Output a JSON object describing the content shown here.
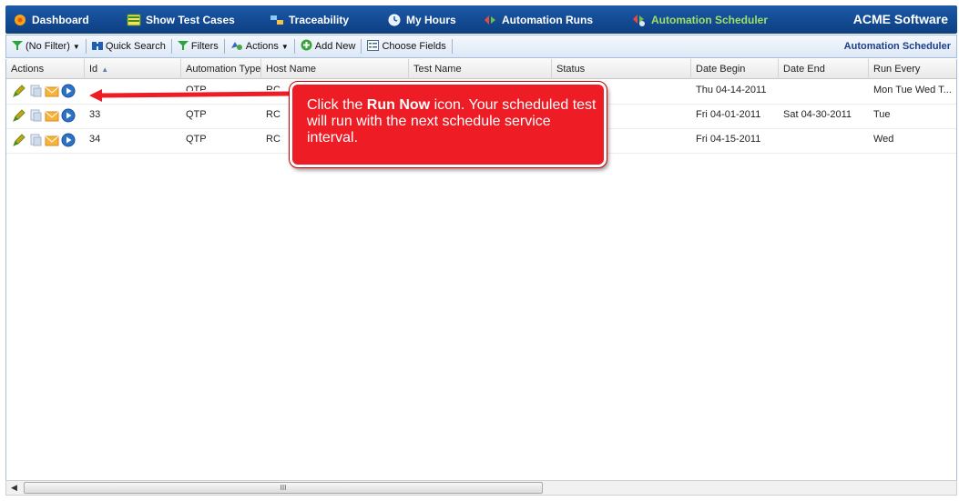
{
  "nav": {
    "tabs": [
      {
        "label": "Dashboard",
        "icon": "dashboard-icon"
      },
      {
        "label": "Show Test Cases",
        "icon": "test-cases-icon"
      },
      {
        "label": "Traceability",
        "icon": "traceability-icon"
      },
      {
        "label": "My Hours",
        "icon": "clock-icon"
      },
      {
        "label": "Automation Runs",
        "icon": "automation-runs-icon"
      },
      {
        "label": "Automation Scheduler",
        "icon": "scheduler-icon",
        "active": true
      }
    ],
    "brand": "ACME Software"
  },
  "toolbar": {
    "filter_label": "(No Filter)",
    "quick_search_label": "Quick Search",
    "filters_label": "Filters",
    "actions_label": "Actions",
    "add_new_label": "Add New",
    "choose_fields_label": "Choose Fields",
    "title": "Automation Scheduler"
  },
  "grid": {
    "columns": [
      "Actions",
      "Id",
      "Automation Type",
      "Host Name",
      "Test Name",
      "Status",
      "Date Begin",
      "Date End",
      "Run Every"
    ],
    "sort_column": "Id",
    "rows": [
      {
        "id": "",
        "type": "QTP",
        "host": "RC",
        "test": "",
        "status": "",
        "begin": "Thu 04-14-2011",
        "end": "",
        "every": "Mon Tue Wed T..."
      },
      {
        "id": "33",
        "type": "QTP",
        "host": "RC",
        "test": "",
        "status": "",
        "begin": "Fri 04-01-2011",
        "end": "Sat 04-30-2011",
        "every": "Tue"
      },
      {
        "id": "34",
        "type": "QTP",
        "host": "RC",
        "test": "",
        "status": "",
        "begin": "Fri 04-15-2011",
        "end": "",
        "every": "Wed"
      }
    ]
  },
  "callout": {
    "text_before": "Click the ",
    "bold": "Run Now",
    "text_after": " icon. Your scheduled test will run with the next schedule service interval."
  },
  "scrollbar": {
    "thumb_grip": "III"
  },
  "colors": {
    "nav_bg": "#134a92",
    "nav_active": "#9fe06a",
    "callout_red": "#ee1c24"
  }
}
